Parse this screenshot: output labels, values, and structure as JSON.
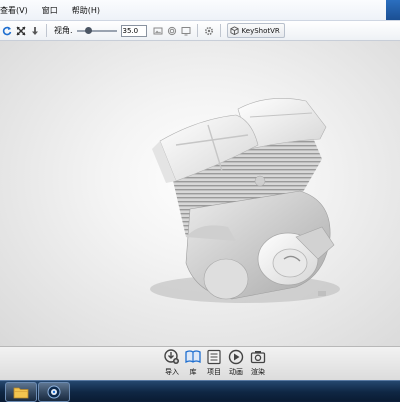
{
  "menu": {
    "items": [
      "查看(V)",
      "窗口",
      "帮助(H)"
    ]
  },
  "toolbar": {
    "refresh_icon": "refresh-icon",
    "fit_icon": "expand-arrows-icon",
    "down_icon": "arrow-down-icon",
    "fov_label": "视角.",
    "fov_value": "35.0",
    "fov_slider_fraction": 0.25,
    "keyshot_vr_label": "KeyShotVR"
  },
  "dock": {
    "import_label": "导入",
    "library_label": "库",
    "project_label": "项目",
    "animation_label": "动画",
    "render_label": "渲染"
  },
  "colors": {
    "accent": "#1f6fd0",
    "taskbar": "#0f2744"
  }
}
